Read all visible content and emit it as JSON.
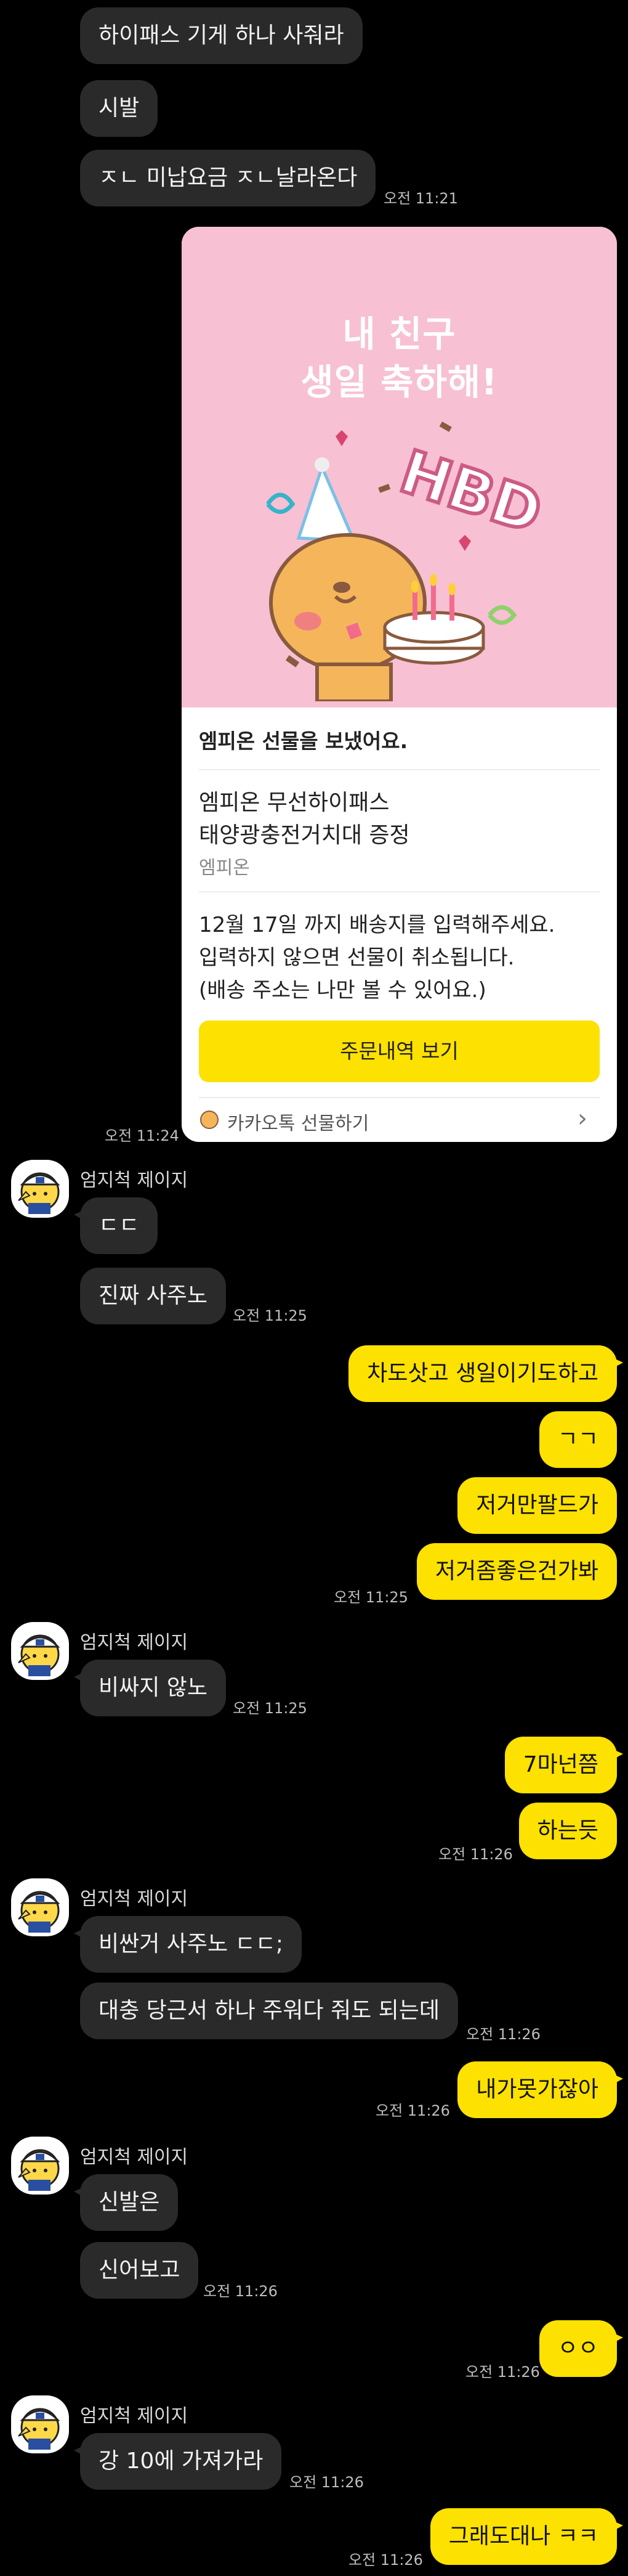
{
  "messages": {
    "m1": "하이패스 기게 하나 사줘라",
    "m2": "시발",
    "m3": "ㅈㄴ 미납요금 ㅈㄴ날라온다",
    "t3": "오전 11:21",
    "t_card": "오전 11:24",
    "sender": "엄지척 제이지",
    "m4": "ㄷㄷ",
    "m5": "진짜 사주노",
    "t5": "오전 11:25",
    "o1": "차도삿고 생일이기도하고",
    "o2": "ㄱㄱ",
    "o3": "저거만팔드가",
    "o4": "저거좀좋은건가봐",
    "t_o4": "오전 11:25",
    "m6": "비싸지 않노",
    "t6": "오전 11:25",
    "o5": "7마넌쯤",
    "o6": "하는듯",
    "t_o6": "오전 11:26",
    "m7": "비싼거 사주노 ㄷㄷ;",
    "m8": "대충 당근서 하나 주워다 줘도 되는데",
    "t8": "오전 11:26",
    "o7": "내가못가잖아",
    "t_o7": "오전 11:26",
    "m9": "신발은",
    "m10": "신어보고",
    "t10": "오전 11:26",
    "o8": "ㅇㅇ",
    "t_o8": "오전 11:26",
    "m11": "강 10에 가져가라",
    "t11": "오전 11:26",
    "o9": "그래도대나 ㅋㅋ",
    "t_o9": "오전 11:26"
  },
  "gift_card": {
    "title_line1": "내 친구",
    "title_line2": "생일 축하해!",
    "balloon_text": "HBD",
    "sent_label": "엠피온 선물을 보냈어요.",
    "product_line1": "엠피온 무선하이패스",
    "product_line2": "태양광충전거치대 증정",
    "brand": "엠피온",
    "notice_line1": "12월 17일 까지 배송지를 입력해주세요.",
    "notice_line2": "입력하지 않으면 선물이 취소됩니다.",
    "notice_line3": "(배송 주소는 나만 볼 수 있어요.)",
    "order_button": "주문내역 보기",
    "footer_label": "카카오톡 선물하기"
  },
  "colors": {
    "background": "#000000",
    "my_bubble": "#fde100",
    "their_bubble": "#2a2a2a",
    "card_header": "#f7c0d3"
  },
  "icons": {
    "avatar": "cap-emoji-avatar",
    "gift_footer": "ryan-gift-icon",
    "chevron": "chevron-right-icon"
  }
}
